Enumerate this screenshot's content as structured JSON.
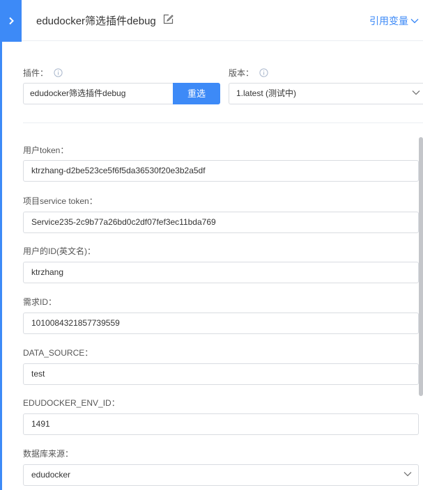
{
  "header": {
    "title": "edudocker筛选插件debug",
    "ref_var_label": "引用变量"
  },
  "plugin": {
    "label": "插件：",
    "value": "edudocker筛选插件debug",
    "reselect_label": "重选"
  },
  "version": {
    "label": "版本：",
    "value": "1.latest (测试中)"
  },
  "fields": [
    {
      "label": "用户token：",
      "value": "ktrzhang-d2be523ce5f6f5da36530f20e3b2a5df"
    },
    {
      "label": "项目service token：",
      "value": "Service235-2c9b77a26bd0c2df07fef3ec11bda769"
    },
    {
      "label": "用户的ID(英文名)：",
      "value": "ktrzhang"
    },
    {
      "label": "需求ID：",
      "value": "1010084321857739559"
    },
    {
      "label": "DATA_SOURCE：",
      "value": "test"
    },
    {
      "label": "EDUDOCKER_ENV_ID：",
      "value": "1491"
    },
    {
      "label": "数据库来源：",
      "value": "edudocker"
    }
  ],
  "colors": {
    "accent": "#3d8af7",
    "border": "#d9dce1",
    "divider": "#ebeef2"
  },
  "icons": [
    "chevron-right-icon",
    "edit-icon",
    "chevron-down-icon",
    "info-icon"
  ]
}
